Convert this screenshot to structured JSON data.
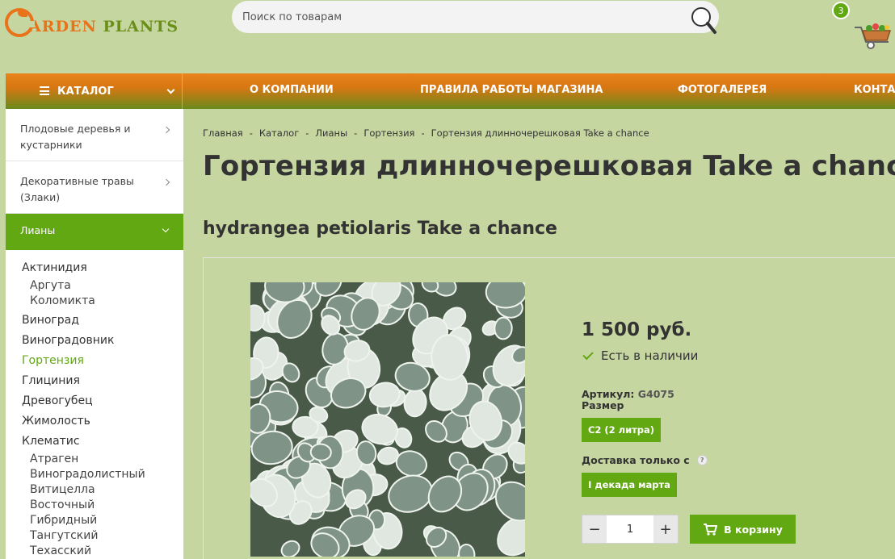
{
  "logo": {
    "g": "G",
    "text1": "ARDEN ",
    "text2": "PLANTS"
  },
  "search": {
    "placeholder": "Поиск по товарам"
  },
  "cart": {
    "count": "3"
  },
  "nav": {
    "catalog_label": "КАТАЛОГ",
    "items": [
      "О КОМПАНИИ",
      "ПРАВИЛА РАБОТЫ МАГАЗИНА",
      "ФОТОГАЛЕРЕЯ",
      "КОНТАКТЫ"
    ]
  },
  "sidebar": {
    "items": [
      {
        "label": "Плодовые деревья и кустарники"
      },
      {
        "label": "Декоративные травы (Злаки)"
      }
    ],
    "active": "Лианы",
    "sub": [
      {
        "label": "Актинидия",
        "children": [
          "Аргута",
          "Коломикта"
        ]
      },
      {
        "label": "Виноград"
      },
      {
        "label": "Виноградовник"
      },
      {
        "label": "Гортензия",
        "current": true
      },
      {
        "label": "Глициния"
      },
      {
        "label": "Древогубец"
      },
      {
        "label": "Жимолость"
      },
      {
        "label": "Клематис",
        "children": [
          "Атраген",
          "Виноградолистный",
          "Витицелла",
          "Восточный",
          "Гибридный",
          "Тангутский",
          "Техасский"
        ]
      }
    ]
  },
  "breadcrumb": [
    "Главная",
    "Каталог",
    "Лианы",
    "Гортензия",
    "Гортензия длинночерешковая Take a chance"
  ],
  "product": {
    "title": "Гортензия длинночерешковая Take a chance",
    "latin": "hydrangea petiolaris Take a chance",
    "price": "1 500 руб.",
    "stock": "Есть в наличии",
    "sku_label": "Артикул:",
    "sku": "G4075",
    "size_label": "Размер",
    "size_option": "С2 (2 литра)",
    "delivery_label": "Доставка только с",
    "delivery_option": "I декада марта",
    "quantity": "1",
    "add_to_cart": "В корзину"
  },
  "colors": {
    "accent": "#62a813",
    "brand_orange": "#e8731a",
    "background": "#c6d6a0"
  }
}
